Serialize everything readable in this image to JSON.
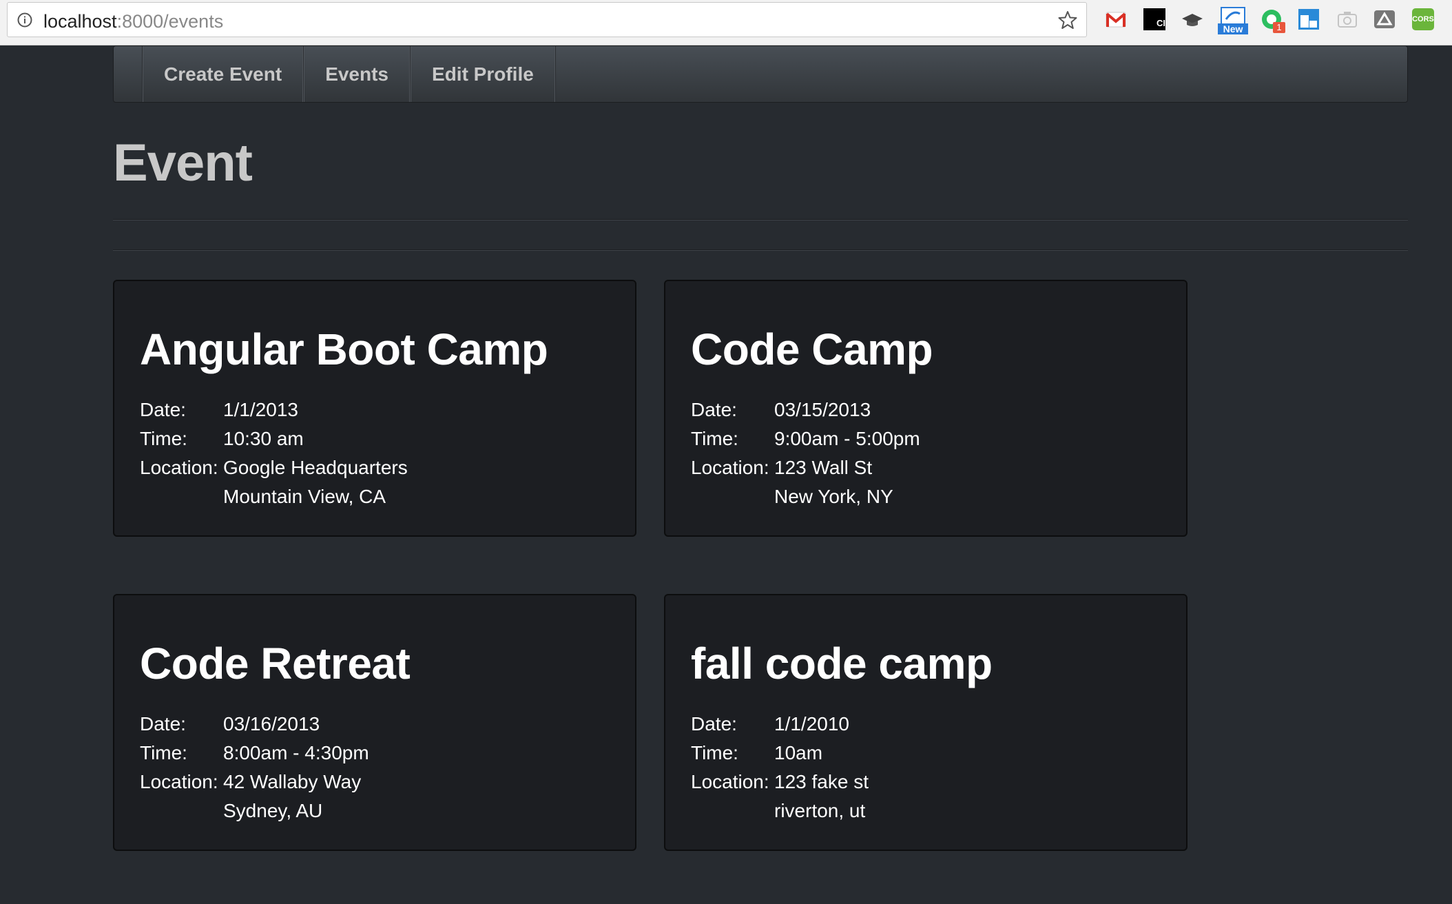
{
  "browser": {
    "url_host": "localhost",
    "url_rest": ":8000/events",
    "extensions": [
      {
        "name": "gmail-icon"
      },
      {
        "name": "ci-icon",
        "text": "CI"
      },
      {
        "name": "graduation-cap-icon"
      },
      {
        "name": "new-extension-icon",
        "badge": "New"
      },
      {
        "name": "evernote-icon",
        "badge": "1"
      },
      {
        "name": "window-icon"
      },
      {
        "name": "camera-icon"
      },
      {
        "name": "drive-icon"
      },
      {
        "name": "cors-icon",
        "text": "CORS"
      }
    ]
  },
  "navbar": {
    "items": [
      {
        "label": "Create Event"
      },
      {
        "label": "Events"
      },
      {
        "label": "Edit Profile"
      }
    ]
  },
  "page": {
    "title": "Event"
  },
  "labels": {
    "date": "Date:",
    "time": "Time:",
    "location": "Location:"
  },
  "events": [
    {
      "name": "Angular Boot Camp",
      "date": "1/1/2013",
      "time": "10:30 am",
      "address": "Google Headquarters",
      "city": "Mountain View, CA"
    },
    {
      "name": "Code Camp",
      "date": "03/15/2013",
      "time": "9:00am - 5:00pm",
      "address": "123 Wall St",
      "city": "New York, NY"
    },
    {
      "name": "Code Retreat",
      "date": "03/16/2013",
      "time": "8:00am - 4:30pm",
      "address": "42 Wallaby Way",
      "city": "Sydney, AU"
    },
    {
      "name": "fall code camp",
      "date": "1/1/2010",
      "time": "10am",
      "address": "123 fake st",
      "city": "riverton, ut"
    }
  ],
  "colors": {
    "page_background": "#272b30",
    "card_background": "#1c1e22",
    "heading_text": "#c8c8c8",
    "card_text": "#ffffff"
  }
}
